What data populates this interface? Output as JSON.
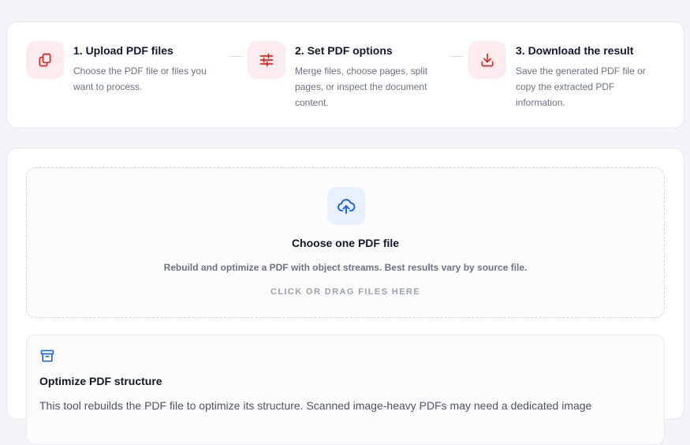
{
  "steps": [
    {
      "title": "1. Upload PDF files",
      "description": "Choose the PDF file or files you want to process.",
      "icon": "copy-files-icon"
    },
    {
      "title": "2. Set PDF options",
      "description": "Merge files, choose pages, split pages, or inspect the document content.",
      "icon": "sliders-icon"
    },
    {
      "title": "3. Download the result",
      "description": "Save the generated PDF file or copy the extracted PDF information.",
      "icon": "download-icon"
    }
  ],
  "dropzone": {
    "icon": "cloud-upload-icon",
    "title": "Choose one PDF file",
    "description": "Rebuild and optimize a PDF with object streams. Best results vary by source file.",
    "hint": "CLICK OR DRAG FILES HERE"
  },
  "info": {
    "icon": "archive-box-icon",
    "title": "Optimize PDF structure",
    "text": "This tool rebuilds the PDF file to optimize its structure. Scanned image-heavy PDFs may need a dedicated image"
  },
  "colors": {
    "accent_red": "#dc2626",
    "accent_blue": "#2563eb",
    "step_icon_bg": "#fdecee",
    "upload_icon_bg": "#e8f0fd"
  }
}
